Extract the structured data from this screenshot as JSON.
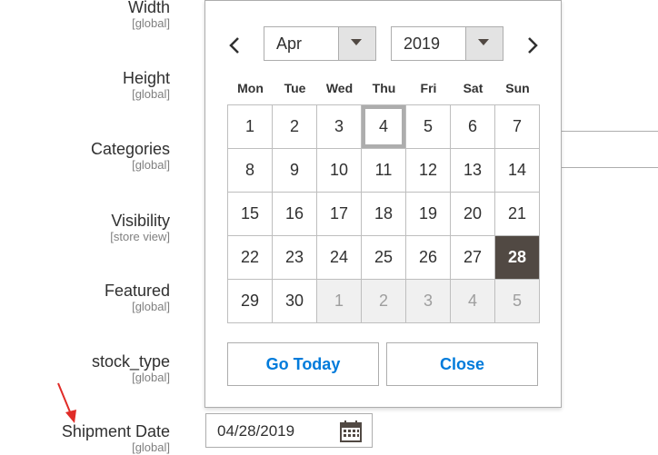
{
  "fields": [
    {
      "label": "Width",
      "scope": "[global]"
    },
    {
      "label": "Height",
      "scope": "[global]"
    },
    {
      "label": "Categories",
      "scope": "[global]"
    },
    {
      "label": "Visibility",
      "scope": "[store view]"
    },
    {
      "label": "Featured",
      "scope": "[global]"
    },
    {
      "label": "stock_type",
      "scope": "[global]"
    },
    {
      "label": "Shipment Date",
      "scope": "[global]"
    }
  ],
  "shipment_date": {
    "value": "04/28/2019",
    "icon": "calendar-icon"
  },
  "datepicker": {
    "prev_icon": "chevron-left-icon",
    "next_icon": "chevron-right-icon",
    "month": "Apr",
    "year": "2019",
    "weekdays": [
      "Mon",
      "Tue",
      "Wed",
      "Thu",
      "Fri",
      "Sat",
      "Sun"
    ],
    "weeks": [
      [
        {
          "d": "1"
        },
        {
          "d": "2"
        },
        {
          "d": "3"
        },
        {
          "d": "4",
          "today": true
        },
        {
          "d": "5"
        },
        {
          "d": "6"
        },
        {
          "d": "7"
        }
      ],
      [
        {
          "d": "8"
        },
        {
          "d": "9"
        },
        {
          "d": "10"
        },
        {
          "d": "11"
        },
        {
          "d": "12"
        },
        {
          "d": "13"
        },
        {
          "d": "14"
        }
      ],
      [
        {
          "d": "15"
        },
        {
          "d": "16"
        },
        {
          "d": "17"
        },
        {
          "d": "18"
        },
        {
          "d": "19"
        },
        {
          "d": "20"
        },
        {
          "d": "21"
        }
      ],
      [
        {
          "d": "22"
        },
        {
          "d": "23"
        },
        {
          "d": "24"
        },
        {
          "d": "25"
        },
        {
          "d": "26"
        },
        {
          "d": "27"
        },
        {
          "d": "28",
          "selected": true
        }
      ],
      [
        {
          "d": "29"
        },
        {
          "d": "30"
        },
        {
          "d": "1",
          "other": true
        },
        {
          "d": "2",
          "other": true
        },
        {
          "d": "3",
          "other": true
        },
        {
          "d": "4",
          "other": true
        },
        {
          "d": "5",
          "other": true
        }
      ]
    ],
    "go_today_label": "Go Today",
    "close_label": "Close"
  },
  "colors": {
    "accent": "#007bdb",
    "selected_bg": "#514943",
    "arrow": "#e02b27"
  }
}
